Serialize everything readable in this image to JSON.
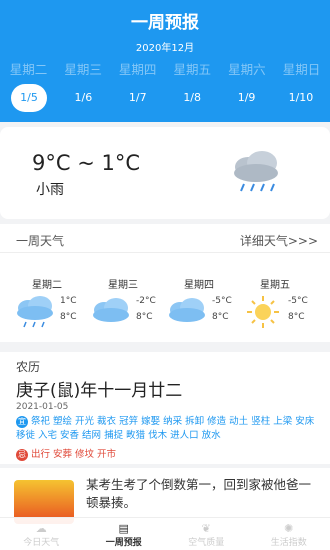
{
  "header": {
    "title": "一周预报",
    "month": "2020年12月",
    "weekdays": [
      "星期二",
      "星期三",
      "星期四",
      "星期五",
      "星期六",
      "星期日"
    ],
    "dates": [
      "1/5",
      "1/6",
      "1/7",
      "1/8",
      "1/9",
      "1/10"
    ],
    "selected_date": "1/5"
  },
  "today": {
    "temp_range": "9°C ~ 1°C",
    "condition": "小雨",
    "icon": "rain-cloud-icon"
  },
  "week": {
    "title": "一周天气",
    "more": "详细天气>>>",
    "days": [
      {
        "name": "星期二",
        "high": "1°C",
        "low": "8°C",
        "cond": "小雨",
        "icon": "rain-cloud-icon"
      },
      {
        "name": "星期三",
        "high": "-2°C",
        "low": "8°C",
        "cond": "阴",
        "icon": "cloud-icon"
      },
      {
        "name": "星期四",
        "high": "-5°C",
        "low": "8°C",
        "cond": "阴",
        "icon": "cloud-icon"
      },
      {
        "name": "星期五",
        "high": "-5°C",
        "low": "8°C",
        "cond": "晴",
        "icon": "sun-icon"
      }
    ]
  },
  "almanac": {
    "heading": "农历",
    "lunar": "庚子(鼠)年十一月廿二",
    "date": "2021-01-05",
    "yi_label": "宜",
    "yi": "祭祀 塑绘 开光 裁衣 冠笄 嫁娶 纳采 拆卸 修造 动土 竖柱 上梁 安床 移徙 入宅 安香 结网 捕捉 畋猎 伐木 进人口 放水",
    "ji_label": "忌",
    "ji": "出行 安葬 修坟 开市"
  },
  "news": {
    "text": "某考生考了个倒数第一，回到家被他爸一顿暴揍。",
    "image": "news-thumbnail"
  },
  "tabbar": {
    "tabs": [
      {
        "label": "今日天气",
        "icon": "home-weather-icon"
      },
      {
        "label": "一周预报",
        "icon": "calendar-icon"
      },
      {
        "label": "空气质量",
        "icon": "leaf-icon"
      },
      {
        "label": "生活指数",
        "icon": "sun-icon"
      }
    ],
    "active": 1
  },
  "colors": {
    "accent": "#1e98f0",
    "ji": "#e04a3a",
    "background": "#f2f3f5"
  }
}
